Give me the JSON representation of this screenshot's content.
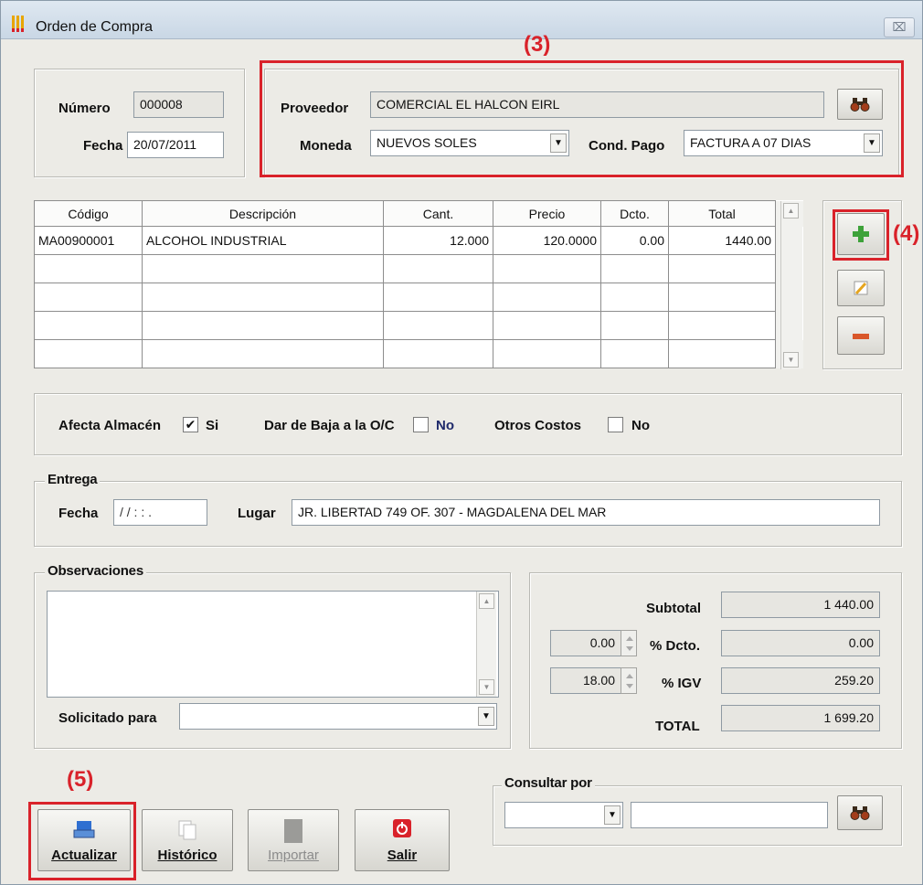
{
  "window": {
    "title": "Orden de Compra",
    "close_glyph": "⌧"
  },
  "annotations": {
    "n3": "(3)",
    "n4": "(4)",
    "n5": "(5)"
  },
  "header": {
    "numero_label": "Número",
    "numero": "000008",
    "fecha_label": "Fecha",
    "fecha": "20/07/2011",
    "proveedor_label": "Proveedor",
    "proveedor": "COMERCIAL EL HALCON EIRL",
    "moneda_label": "Moneda",
    "moneda": "NUEVOS SOLES",
    "cond_pago_label": "Cond. Pago",
    "cond_pago": "FACTURA A 07 DIAS"
  },
  "grid": {
    "columns": [
      "Código",
      "Descripción",
      "Cant.",
      "Precio",
      "Dcto.",
      "Total"
    ],
    "rows": [
      [
        "MA00900001",
        "ALCOHOL INDUSTRIAL",
        "12.000",
        "120.0000",
        "0.00",
        "1440.00"
      ]
    ]
  },
  "flags": {
    "afecta_label": "Afecta Almacén",
    "afecta_value": "Si",
    "afecta_checked": "✔",
    "baja_label": "Dar de Baja a la O/C",
    "baja_value": "No",
    "otros_label": "Otros Costos",
    "otros_value": "No"
  },
  "entrega": {
    "group_label": "Entrega",
    "fecha_label": "Fecha",
    "fecha_mask": "/ /     : : .",
    "lugar_label": "Lugar",
    "lugar": "JR. LIBERTAD 749 OF. 307 - MAGDALENA DEL MAR"
  },
  "observaciones": {
    "group_label": "Observaciones",
    "text": "",
    "solicitado_label": "Solicitado para",
    "solicitado": ""
  },
  "totals": {
    "subtotal_label": "Subtotal",
    "subtotal": "1 440.00",
    "dcto_pct": "0.00",
    "dcto_label": "% Dcto.",
    "dcto": "0.00",
    "igv_pct": "18.00",
    "igv_label": "% IGV",
    "igv": "259.20",
    "total_label": "TOTAL",
    "total": "1 699.20"
  },
  "consultar": {
    "group_label": "Consultar por",
    "field": "",
    "value": ""
  },
  "buttons": {
    "actualizar": "Actualizar",
    "historico": "Histórico",
    "importar": "Importar",
    "salir": "Salir"
  },
  "colors": {
    "annotation_red": "#d9222a",
    "add_green": "#3ea23a",
    "remove_red": "#d9572a"
  }
}
